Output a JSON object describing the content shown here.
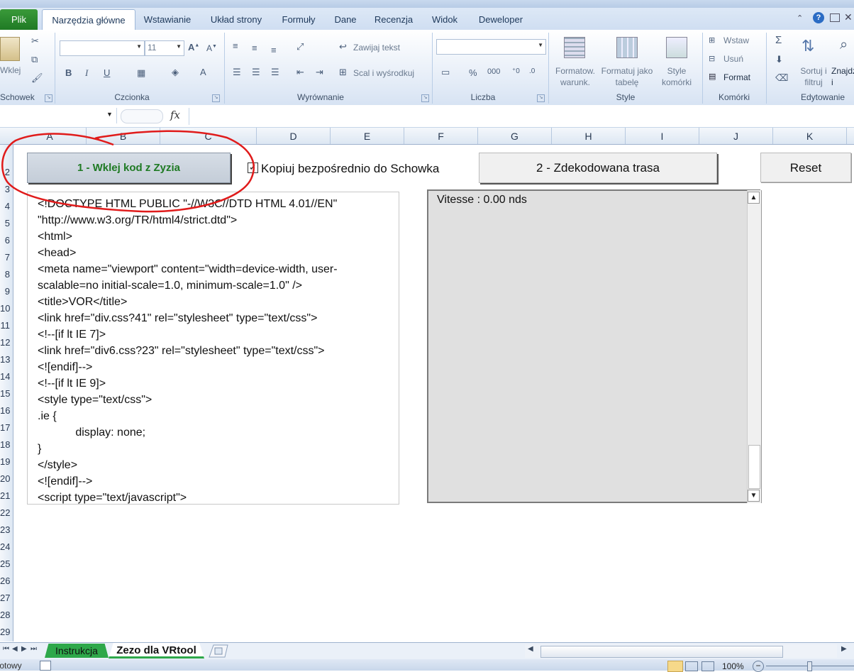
{
  "ribbon": {
    "tabs": [
      "Plik",
      "Narzędzia główne",
      "Wstawianie",
      "Układ strony",
      "Formuły",
      "Dane",
      "Recenzja",
      "Widok",
      "Deweloper"
    ],
    "groups": {
      "clipboard": "Schowek",
      "clipboard_paste": "Wklej",
      "font": "Czcionka",
      "font_size": "11",
      "alignment": "Wyrównanie",
      "wrap_text": "Zawijaj tekst",
      "merge_center": "Scal i wyśrodkuj",
      "number": "Liczba",
      "styles": "Style",
      "cond_format": "Formatow. warunk.",
      "format_table": "Formatuj jako tabelę",
      "cell_styles": "Style komórki",
      "cells": "Komórki",
      "insert": "Wstaw",
      "delete": "Usuń",
      "format": "Format",
      "editing": "Edytowanie",
      "sort_filter": "Sortuj i filtruj",
      "find_select": "Znajdź i zaznacz"
    }
  },
  "formula_bar": {
    "fx": "fx",
    "value": ""
  },
  "columns": [
    "A",
    "B",
    "C",
    "D",
    "E",
    "F",
    "G",
    "H",
    "I",
    "J",
    "K"
  ],
  "rows": [
    "2",
    "3",
    "4",
    "5",
    "6",
    "7",
    "8",
    "9",
    "10",
    "11",
    "12",
    "13",
    "14",
    "15",
    "16",
    "17",
    "18",
    "19",
    "20",
    "21",
    "22",
    "23",
    "24",
    "25",
    "26",
    "27",
    "28",
    "29"
  ],
  "sheet": {
    "paste_button": "1 - Wklej kod z Zyzia",
    "copy_checkbox_label": "Kopiuj bezpośrednio do Schowka",
    "copy_checkbox_checked": true,
    "route_button": "2 - Zdekodowana trasa",
    "reset_button": "Reset",
    "code_text": "<!DOCTYPE HTML PUBLIC \"-//W3C//DTD HTML 4.01//EN\"\n\"http://www.w3.org/TR/html4/strict.dtd\">\n<html>\n<head>\n<meta name=\"viewport\" content=\"width=device-width, user-\nscalable=no initial-scale=1.0, minimum-scale=1.0\" />\n<title>VOR</title>\n<link href=\"div.css?41\" rel=\"stylesheet\" type=\"text/css\">\n<!--[if lt IE 7]>\n<link href=\"div6.css?23\" rel=\"stylesheet\" type=\"text/css\">\n<![endif]-->\n<!--[if lt IE 9]>\n<style type=\"text/css\">\n.ie {\n            display: none;\n}\n</style>\n<![endif]-->\n<script type=\"text/javascript\">",
    "speed_text": "Vitesse : 0.00 nds"
  },
  "sheet_tabs": [
    "Instrukcja",
    "Zezo dla VRtool"
  ],
  "status": {
    "left": "Gotowy",
    "zoom": "100%"
  },
  "colors": {
    "accent_green": "#2ea84a",
    "annotation_red": "#e01b1b",
    "ribbon_blue": "#dde8f6"
  }
}
